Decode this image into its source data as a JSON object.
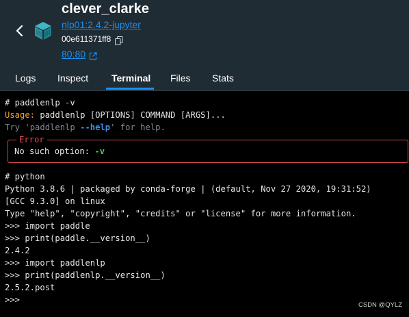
{
  "header": {
    "container_name": "clever_clarke",
    "image": "nlp01:2.4.2-jupyter",
    "container_id": "00e611371ff8",
    "port": "80:80",
    "back_icon": "chevron-left-icon",
    "container_icon": "cube-icon",
    "copy_icon": "copy-icon",
    "external_icon": "external-link-icon"
  },
  "tabs": [
    {
      "label": "Logs"
    },
    {
      "label": "Inspect"
    },
    {
      "label": "Terminal",
      "active": true
    },
    {
      "label": "Files"
    },
    {
      "label": "Stats"
    }
  ],
  "terminal": {
    "cmd1": "# paddlenlp -v",
    "usage_label": "Usage:",
    "usage_text": " paddlenlp [OPTIONS] COMMAND [ARGS]...",
    "try_prefix": "Try '",
    "try_cmd": "paddlenlp ",
    "try_flag": "--help",
    "try_suffix": "' for help.",
    "error_title": "Error",
    "error_text": "No such option: ",
    "error_option": "-v",
    "lines": [
      "# python",
      "Python 3.8.6 | packaged by conda-forge | (default, Nov 27 2020, 19:31:52)",
      "[GCC 9.3.0] on linux",
      "Type \"help\", \"copyright\", \"credits\" or \"license\" for more information.",
      ">>> import paddle",
      ">>> print(paddle.__version__)",
      "2.4.2",
      ">>> import paddlenlp",
      ">>> print(paddlenlp.__version__)",
      "2.5.2.post",
      ">>>"
    ]
  },
  "watermark": "CSDN @QYLZ",
  "colors": {
    "header_bg": "#202c33",
    "accent": "#1d8ff0",
    "usage": "#f5a623",
    "error": "#d84b4b",
    "option": "#4ec94e"
  }
}
